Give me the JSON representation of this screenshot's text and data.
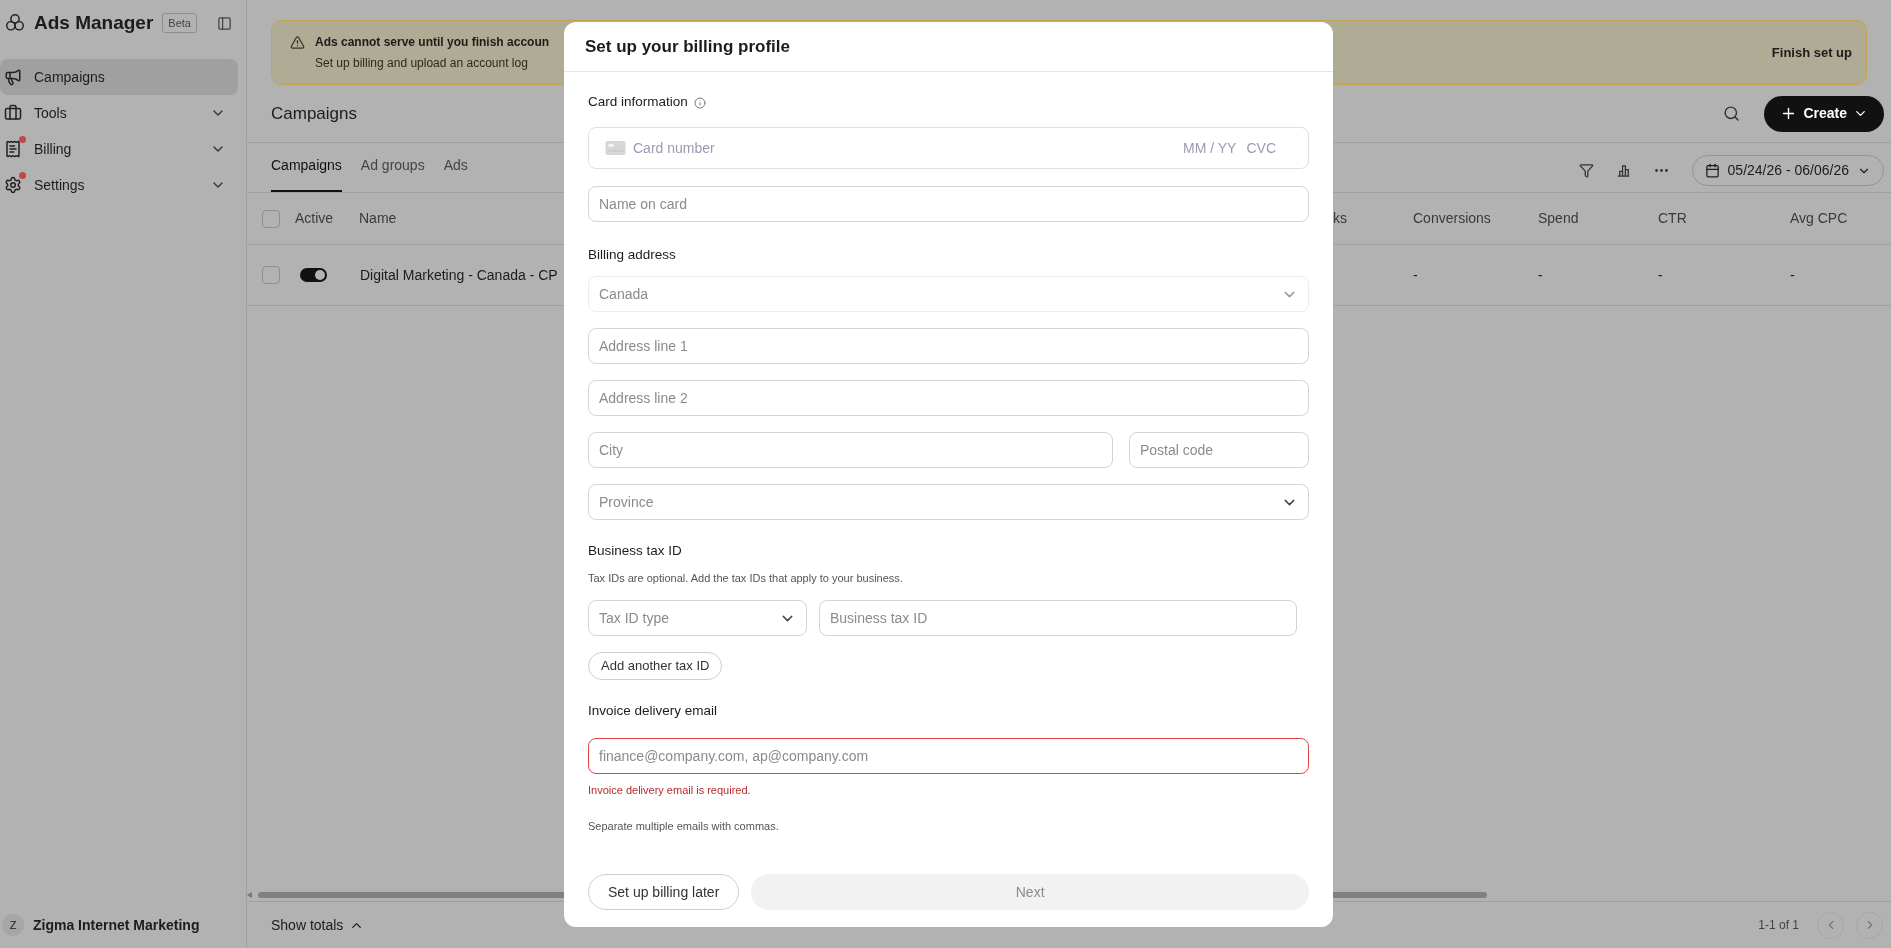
{
  "sidebar": {
    "brand": "Ads Manager",
    "badge": "Beta",
    "items": [
      {
        "label": "Campaigns",
        "selected": true,
        "has_submenu": false,
        "alert": false
      },
      {
        "label": "Tools",
        "selected": false,
        "has_submenu": true,
        "alert": false
      },
      {
        "label": "Billing",
        "selected": false,
        "has_submenu": true,
        "alert": true
      },
      {
        "label": "Settings",
        "selected": false,
        "has_submenu": true,
        "alert": true
      }
    ],
    "account": {
      "initial": "Z",
      "name": "Zigma Internet Marketing"
    }
  },
  "banner": {
    "title": "Ads cannot serve until you finish accoun",
    "text": "Set up billing and upload an account log",
    "action": "Finish set up"
  },
  "page": {
    "title": "Campaigns",
    "create": "Create",
    "tabs": [
      {
        "label": "Campaigns",
        "selected": true
      },
      {
        "label": "Ad groups",
        "selected": false
      },
      {
        "label": "Ads",
        "selected": false
      }
    ],
    "date_range": "05/24/26 - 06/06/26"
  },
  "table": {
    "select_all_checked": false,
    "columns_left": [
      "Active",
      "Name"
    ],
    "columns_right": [
      "ks",
      "Conversions",
      "Spend",
      "CTR",
      "Avg CPC"
    ],
    "rows": [
      {
        "checked": false,
        "active": true,
        "name": "Digital Marketing - Canada - CP",
        "cells": [
          "-",
          "-",
          "-",
          "-"
        ]
      }
    ]
  },
  "footer": {
    "show_totals": "Show totals",
    "pagination": "1-1 of 1"
  },
  "modal": {
    "title": "Set up your billing profile",
    "card": {
      "label": "Card information",
      "number_placeholder": "Card number",
      "expiry_placeholder": "MM / YY",
      "cvc_placeholder": "CVC",
      "name_placeholder": "Name on card"
    },
    "address": {
      "label": "Billing address",
      "country": {
        "value": "Canada",
        "disabled": true
      },
      "line1_placeholder": "Address line 1",
      "line2_placeholder": "Address line 2",
      "city_placeholder": "City",
      "postal_placeholder": "Postal code",
      "province_placeholder": "Province"
    },
    "tax": {
      "label": "Business tax ID",
      "help": "Tax IDs are optional. Add the tax IDs that apply to your business.",
      "type_placeholder": "Tax ID type",
      "id_placeholder": "Business tax ID",
      "add_button": "Add another tax ID"
    },
    "email": {
      "label": "Invoice delivery email",
      "placeholder": "finance@company.com, ap@company.com",
      "error": "Invoice delivery email is required.",
      "help": "Separate multiple emails with commas."
    },
    "later_button": "Set up billing later",
    "next": {
      "label": "Next",
      "disabled": true
    }
  }
}
